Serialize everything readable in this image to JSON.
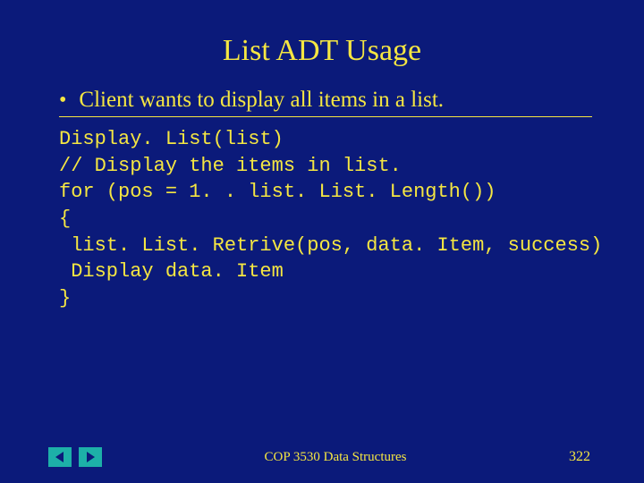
{
  "title": "List ADT Usage",
  "bullet": "Client wants to display all items in a list.",
  "code": "Display. List(list)\n// Display the items in list.\nfor (pos = 1. . list. List. Length())\n{\n list. List. Retrive(pos, data. Item, success)\n Display data. Item\n}",
  "footer": {
    "center": "COP 3530 Data Structures",
    "page": "322"
  }
}
